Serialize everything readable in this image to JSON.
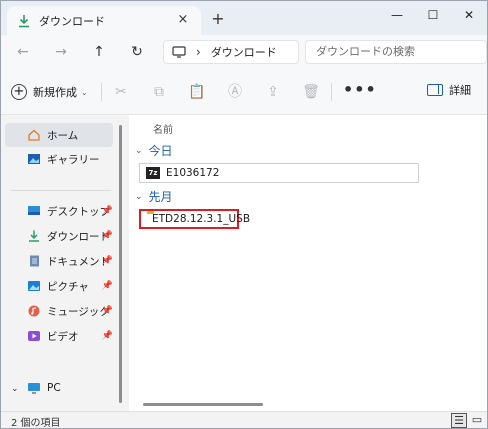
{
  "window": {
    "tab_title": "ダウンロード",
    "tab_close": "×",
    "new_tab": "+",
    "minimize": "—",
    "maximize": "☐",
    "close": "✕"
  },
  "address": {
    "back": "←",
    "forward": "→",
    "up": "↑",
    "refresh": "↻",
    "separator": "›",
    "location": "ダウンロード",
    "search_placeholder": "ダウンロードの検索"
  },
  "commands": {
    "new_label": "新規作成",
    "more": "•••",
    "details_label": "詳細"
  },
  "nav": {
    "items": [
      {
        "label": "ホーム",
        "icon": "home-icon",
        "selected": true
      },
      {
        "label": "ギャラリー",
        "icon": "gallery-icon"
      },
      {
        "label": "デスクトップ",
        "icon": "desktop-icon",
        "pinned": true
      },
      {
        "label": "ダウンロード",
        "icon": "download-icon",
        "pinned": true
      },
      {
        "label": "ドキュメント",
        "icon": "documents-icon",
        "pinned": true
      },
      {
        "label": "ピクチャ",
        "icon": "pictures-icon",
        "pinned": true
      },
      {
        "label": "ミュージック",
        "icon": "music-icon",
        "pinned": true
      },
      {
        "label": "ビデオ",
        "icon": "videos-icon",
        "pinned": true
      },
      {
        "label": "PC",
        "icon": "pc-icon"
      }
    ],
    "pin_glyph": "📌"
  },
  "content": {
    "column_name": "名前",
    "groups": [
      {
        "label": "今日",
        "files": [
          {
            "name": "E1036172",
            "icon": "7zip-icon",
            "icon_text": "7z"
          }
        ]
      },
      {
        "label": "先月",
        "files": [
          {
            "name": "ETD28.12.3.1_USB",
            "icon": "folder-icon"
          }
        ]
      }
    ]
  },
  "status": {
    "count_text": "2 個の項目"
  },
  "colors": {
    "accent": "#1a5fb4",
    "highlight_box": "#e01b24",
    "folder": "#f4c542"
  }
}
